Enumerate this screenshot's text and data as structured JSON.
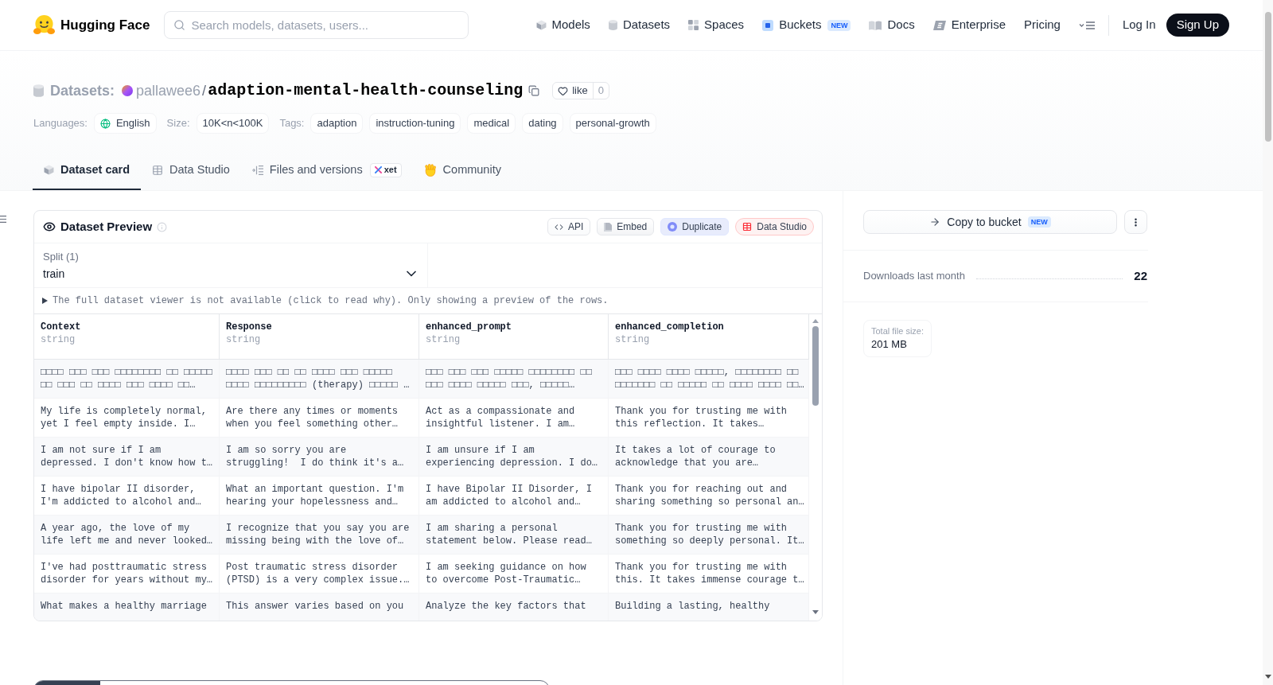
{
  "header": {
    "logo": "Hugging Face",
    "search": {
      "placeholder": "Search models, datasets, users..."
    },
    "nav": [
      {
        "label": "Models"
      },
      {
        "label": "Datasets"
      },
      {
        "label": "Spaces"
      },
      {
        "label": "Buckets",
        "badge": "NEW"
      },
      {
        "label": "Docs"
      },
      {
        "label": "Enterprise"
      },
      {
        "label": "Pricing"
      }
    ],
    "auth": [
      {
        "label": "Log In",
        "kind": "link"
      },
      {
        "label": "Sign Up",
        "kind": "primary"
      }
    ]
  },
  "repo": {
    "section": "Datasets:",
    "owner": "pallawee6",
    "separator": "/",
    "name": "adaption-mental-health-counseling",
    "like": {
      "label": "like",
      "count": "0"
    }
  },
  "tag_groups": [
    {
      "label": "Languages:",
      "chips": [
        {
          "text": "English",
          "kind": "language"
        }
      ]
    },
    {
      "label": "Size:",
      "chips": [
        {
          "text": "10K<n<100K",
          "kind": "plain"
        }
      ]
    },
    {
      "label": "Tags:",
      "chips": [
        {
          "text": "adaption",
          "kind": "plain"
        },
        {
          "text": "instruction-tuning",
          "kind": "plain"
        },
        {
          "text": "medical",
          "kind": "plain"
        },
        {
          "text": "dating",
          "kind": "plain"
        },
        {
          "text": "personal-growth",
          "kind": "plain"
        }
      ]
    }
  ],
  "tabs": [
    {
      "label": "Dataset card",
      "selected": true
    },
    {
      "label": "Data Studio",
      "selected": false
    },
    {
      "label": "Files and versions",
      "badge": "xet",
      "selected": false
    },
    {
      "label": "Community",
      "selected": false
    }
  ],
  "preview": {
    "title": "Dataset Preview",
    "actions": [
      {
        "label": "API",
        "kind": "code"
      },
      {
        "label": "Embed",
        "kind": "embed"
      },
      {
        "label": "Duplicate",
        "kind": "duplicate"
      },
      {
        "label": "Data Studio",
        "kind": "studio"
      }
    ],
    "split": {
      "label": "Split (1)",
      "value": "train"
    },
    "notice": "The full dataset viewer is not available (click to read why). Only showing a preview of the rows.",
    "table": {
      "columns": [
        {
          "name": "Context",
          "type": "string"
        },
        {
          "name": "Response",
          "type": "string"
        },
        {
          "name": "enhanced_prompt",
          "type": "string"
        },
        {
          "name": "enhanced_completion",
          "type": "string"
        }
      ],
      "rows": [
        [
          "□□□□ □□□ □□□ □□□□□□□□ □□ □□□□□\n□□ □□□ □□ □□□□ □□□ □□□□ □□…",
          "□□□□ □□□ □□ □□ □□□□ □□□ □□□□□\n□□□□ □□□□□□□□□ (therapy) □□□□□ …",
          "□□□ □□□ □□□ □□□□□ □□□□□□□□ □□\n□□□ □□□□ □□□□□ □□□, □□□□□…",
          "□□□ □□□□ □□□□ □□□□□, □□□□□□□□ □□\n□□□□□□□ □□ □□□□□ □□ □□□□ □□□□ □□…"
        ],
        [
          "My life is completely normal,\nyet I feel empty inside. I…",
          "Are there any times or moments\nwhen you feel something other…",
          "Act as a compassionate and\ninsightful listener. I am…",
          "Thank you for trusting me with\nthis reflection. It takes…"
        ],
        [
          "I am not sure if I am\ndepressed. I don't know how t…",
          "I am so sorry you are\nstruggling!  I do think it's a…",
          "I am unsure if I am\nexperiencing depression. I do…",
          "It takes a lot of courage to\nacknowledge that you are…"
        ],
        [
          "I have bipolar II disorder,\nI'm addicted to alcohol and…",
          "What an important question. I'm\nhearing your hopelessness and…",
          "I have Bipolar II Disorder, I\nam addicted to alcohol and…",
          "Thank you for reaching out and\nsharing something so personal an…"
        ],
        [
          "A year ago, the love of my\nlife left me and never looked…",
          "I recognize that you say you are\nmissing being with the love of…",
          "I am sharing a personal\nstatement below. Please read…",
          "Thank you for trusting me with\nsomething so deeply personal. It…"
        ],
        [
          "I've had posttraumatic stress\ndisorder for years without my…",
          "Post traumatic stress disorder\n(PTSD) is a very complex issue.…",
          "I am seeking guidance on how\nto overcome Post-Traumatic…",
          "Thank you for trusting me with\nthis. It takes immense courage t…"
        ],
        [
          "What makes a healthy marriage",
          "This answer varies based on you",
          "Analyze the key factors that",
          "Building a lasting, healthy"
        ]
      ]
    }
  },
  "sidebar": {
    "copy_button": {
      "label": "Copy to bucket",
      "badge": "NEW"
    },
    "downloads": {
      "label": "Downloads last month",
      "value": "22"
    },
    "file_size": {
      "label": "Total file size:",
      "value": "201 MB"
    }
  }
}
